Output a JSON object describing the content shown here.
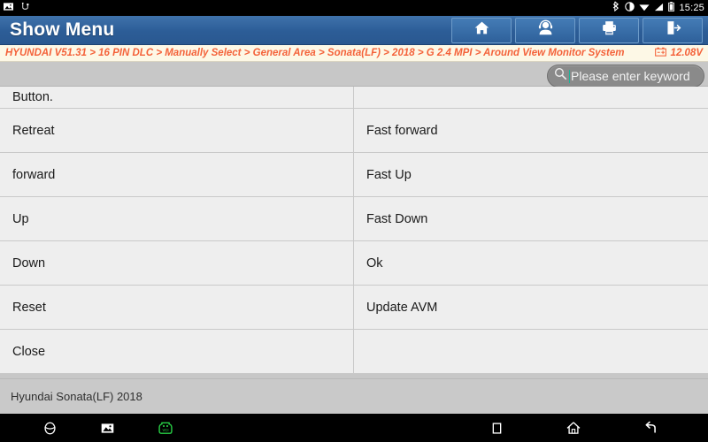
{
  "statusbar": {
    "icons_left": [
      "screenshot-icon",
      "usb-icon"
    ],
    "icons_right": [
      "bluetooth-icon",
      "dnd-icon",
      "wifi-icon",
      "signal-icon",
      "battery-icon"
    ],
    "time": "15:25"
  },
  "header": {
    "title": "Show Menu",
    "buttons": [
      {
        "name": "home-button",
        "icon": "home-icon"
      },
      {
        "name": "support-button",
        "icon": "headset-icon"
      },
      {
        "name": "print-button",
        "icon": "printer-icon"
      },
      {
        "name": "exit-button",
        "icon": "exit-icon"
      }
    ]
  },
  "breadcrumb": {
    "path": "HYUNDAI V51.31 > 16 PIN DLC > Manually Select > General Area > Sonata(LF) > 2018 > G 2.4 MPI > Around View Monitor System",
    "battery_icon": "battery-voltage-icon",
    "voltage": "12.08V"
  },
  "search": {
    "icon": "search-icon",
    "placeholder": "Please enter keyword",
    "value": ""
  },
  "list": {
    "rows": [
      {
        "left": "Button.",
        "right": "",
        "clipped": true
      },
      {
        "left": "Retreat",
        "right": "Fast forward",
        "clipped": false
      },
      {
        "left": "forward",
        "right": "Fast Up",
        "clipped": false
      },
      {
        "left": "Up",
        "right": "Fast Down",
        "clipped": false
      },
      {
        "left": "Down",
        "right": "Ok",
        "clipped": false
      },
      {
        "left": "Reset",
        "right": "Update AVM",
        "clipped": false
      },
      {
        "left": "Close",
        "right": "",
        "clipped": false
      }
    ]
  },
  "footer": {
    "vehicle": "Hyundai Sonata(LF) 2018"
  },
  "navbar": {
    "left_icons": [
      "browser-icon",
      "gallery-icon",
      "vci-icon"
    ],
    "right_icons": [
      "recents-icon",
      "home-icon",
      "back-icon"
    ],
    "vci_color": "#28d146"
  },
  "colors": {
    "header_blue": "#2c5d97",
    "breadcrumb_text": "#f4623a",
    "breadcrumb_bg": "#fdf8e6",
    "row_bg": "#eeeeee",
    "strip_gray": "#c7c7c7"
  }
}
